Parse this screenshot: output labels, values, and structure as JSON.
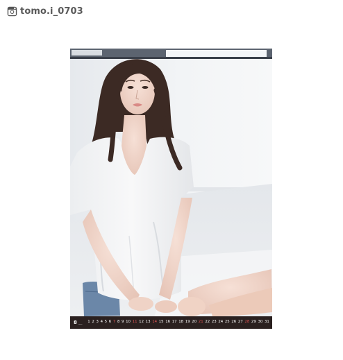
{
  "header": {
    "icon": "instagram-icon",
    "username": "tomo.i_0703"
  },
  "photo": {
    "kind": "calendar-photo",
    "colors": {
      "wall": "#f0f2f5",
      "shirt": "#f3f3f4",
      "hair": "#3c2a24",
      "skin": "#f2d8cc",
      "denim": "#6b87a8"
    }
  },
  "calendar": {
    "month": "8",
    "month_suffix": "___",
    "days": [
      {
        "n": "1",
        "red": false
      },
      {
        "n": "2",
        "red": false
      },
      {
        "n": "3",
        "red": false
      },
      {
        "n": "4",
        "red": false
      },
      {
        "n": "5",
        "red": false
      },
      {
        "n": "6",
        "red": false
      },
      {
        "n": "7",
        "red": true
      },
      {
        "n": "8",
        "red": false
      },
      {
        "n": "9",
        "red": false
      },
      {
        "n": "10",
        "red": false
      },
      {
        "n": "11",
        "red": true
      },
      {
        "n": "12",
        "red": false
      },
      {
        "n": "13",
        "red": false
      },
      {
        "n": "14",
        "red": true
      },
      {
        "n": "15",
        "red": false
      },
      {
        "n": "16",
        "red": false
      },
      {
        "n": "17",
        "red": false
      },
      {
        "n": "18",
        "red": false
      },
      {
        "n": "19",
        "red": false
      },
      {
        "n": "20",
        "red": false
      },
      {
        "n": "21",
        "red": true
      },
      {
        "n": "22",
        "red": false
      },
      {
        "n": "23",
        "red": false
      },
      {
        "n": "24",
        "red": false
      },
      {
        "n": "25",
        "red": false
      },
      {
        "n": "26",
        "red": false
      },
      {
        "n": "27",
        "red": false
      },
      {
        "n": "28",
        "red": true
      },
      {
        "n": "29",
        "red": false
      },
      {
        "n": "30",
        "red": false
      },
      {
        "n": "31",
        "red": false
      }
    ],
    "colors": {
      "strip": "#2a201f",
      "text": "#ffffff",
      "holiday": "#e45656"
    }
  }
}
